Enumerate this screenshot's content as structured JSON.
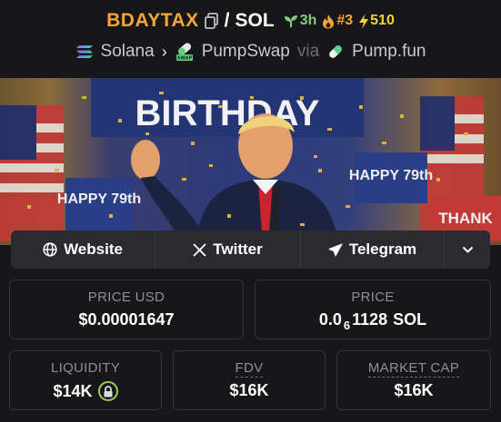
{
  "header": {
    "token_symbol": "BDAYTAX",
    "separator": "/",
    "quote_symbol": "SOL",
    "age": "3h",
    "rank": "#3",
    "boosts": "510",
    "chain": "Solana",
    "dex": "PumpSwap",
    "via_label": "via",
    "launchpad": "Pump.fun"
  },
  "links": {
    "website": "Website",
    "twitter": "Twitter",
    "telegram": "Telegram"
  },
  "banner": {
    "sign_top": "BIRTHDAY",
    "sign_left": "HAPPY 79th",
    "sign_right": "HAPPY 79th",
    "sign_far_right": "THANK"
  },
  "stats": {
    "price_usd_label": "PRICE USD",
    "price_usd_value": "$0.00001647",
    "price_label": "PRICE",
    "price_prefix": "0.0",
    "price_zero_count": "6",
    "price_digits": "1128",
    "price_unit": "SOL",
    "liquidity_label": "LIQUIDITY",
    "liquidity_value": "$14K",
    "fdv_label": "FDV",
    "fdv_value": "$16K",
    "mcap_label": "MARKET CAP",
    "mcap_value": "$16K"
  },
  "colors": {
    "token": "#f6a53a",
    "age": "#7ed07e",
    "boost": "#f4d43a",
    "lock_ring": "#9acd5a"
  }
}
